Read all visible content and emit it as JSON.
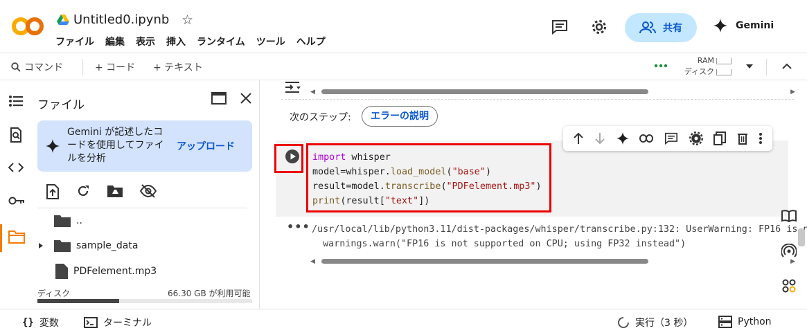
{
  "header": {
    "notebook_title": "Untitled0.ipynb",
    "menu": [
      "ファイル",
      "編集",
      "表示",
      "挿入",
      "ランタイム",
      "ツール",
      "ヘルプ"
    ],
    "share_label": "共有",
    "gemini_label": "Gemini"
  },
  "toolbar": {
    "command_label": "コマンド",
    "add_code_label": "+ コード",
    "add_text_label": "+ テキスト",
    "ram_label": "RAM",
    "disk_label": "ディスク",
    "status_color": "#1e8e3e"
  },
  "left_rail": {
    "icons": [
      "table-of-contents-icon",
      "find-icon",
      "code-snippets-icon",
      "secrets-key-icon",
      "files-folder-icon"
    ],
    "active_accent": "#f57c00"
  },
  "files_panel": {
    "title": "ファイル",
    "gemini_card": {
      "text": "Gemini が記述したコードを使用してファイルを分析",
      "upload_label": "アップロード"
    },
    "items": [
      {
        "name": "..",
        "type": "folder"
      },
      {
        "name": "sample_data",
        "type": "folder"
      },
      {
        "name": "PDFelement.mp3",
        "type": "file"
      }
    ],
    "disk_label": "ディスク",
    "disk_free": "66.30 GB が利用可能",
    "disk_used_fraction": 0.38
  },
  "notebook": {
    "next_steps_label": "次のステップ:",
    "explain_error_label": "エラーの説明",
    "code_lines": [
      "import whisper",
      "model=whisper.load_model(\"base\")",
      "result=model.transcribe(\"PDFelement.mp3\")",
      "print(result[\"text\"])"
    ],
    "output_lines": [
      "/usr/local/lib/python3.11/dist-packages/whisper/transcribe.py:132: UserWarning: FP16 is n",
      "  warnings.warn(\"FP16 is not supported on CPU; using FP32 instead\")"
    ],
    "highlight_color": "#e00000"
  },
  "statusbar": {
    "variables_label": "変数",
    "terminal_label": "ターミナル",
    "execution_label": "実行（3 秒）",
    "python_label": "Python"
  }
}
